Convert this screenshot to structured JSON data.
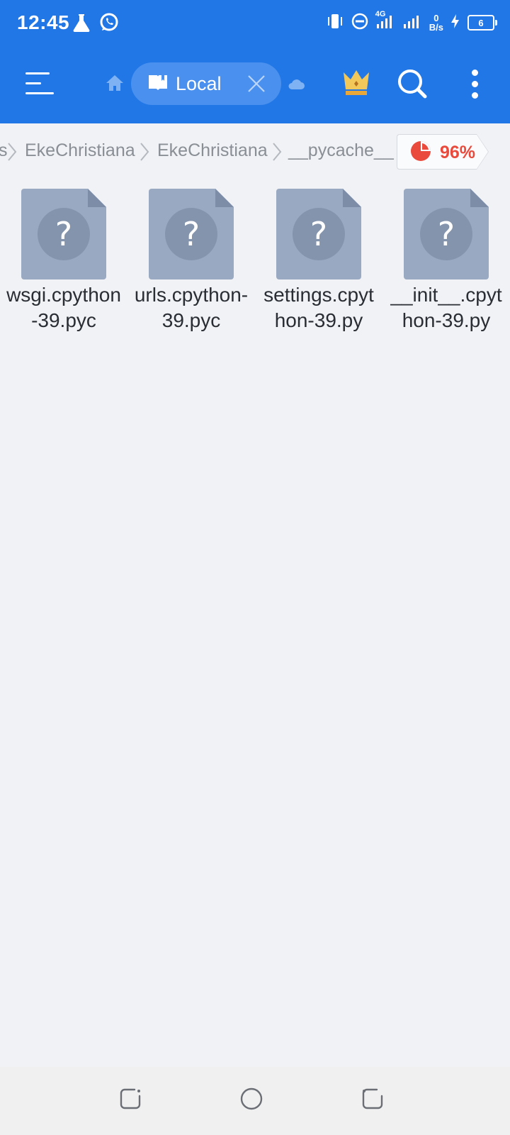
{
  "status_bar": {
    "time": "12:45",
    "network_type": "4G",
    "net_speed_value": "0",
    "net_speed_unit": "B/s",
    "battery_level": "6"
  },
  "app_bar": {
    "tab_label": "Local"
  },
  "breadcrumb": {
    "items": [
      "s",
      "EkeChristiana",
      "EkeChristiana",
      "__pycache__"
    ],
    "storage_percent": "96%"
  },
  "files": [
    {
      "name": "wsgi.cpython-39.pyc"
    },
    {
      "name": "urls.cpython-39.pyc"
    },
    {
      "name": "settings.cpython-39.py"
    },
    {
      "name": "__init__.cpython-39.py"
    }
  ],
  "colors": {
    "accent": "#2277e6",
    "storage_warning": "#e94a3c",
    "file_icon": "#9aa9c2"
  }
}
